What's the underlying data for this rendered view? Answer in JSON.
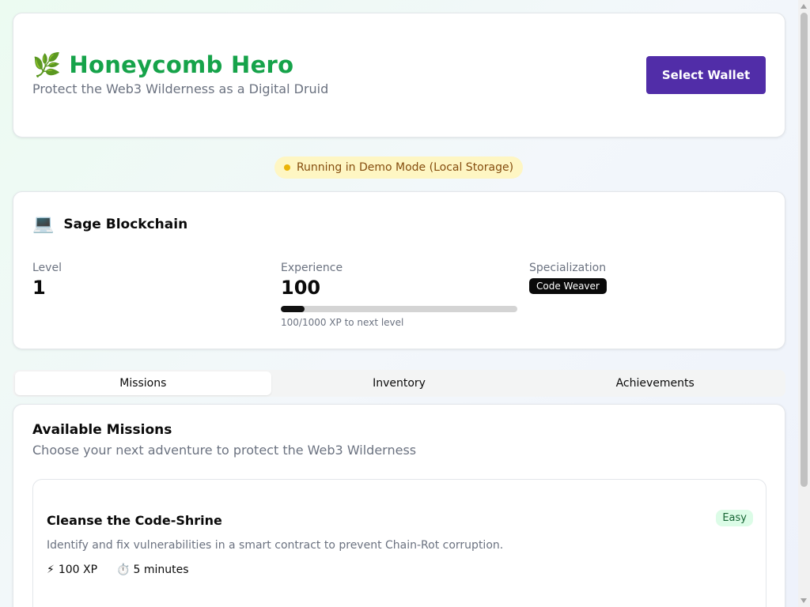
{
  "header": {
    "logo_icon": "🌿",
    "title": "Honeycomb Hero",
    "subtitle": "Protect the Web3 Wilderness as a Digital Druid",
    "wallet_button": "Select Wallet"
  },
  "demo_banner": "Running in Demo Mode (Local Storage)",
  "character": {
    "avatar_icon": "💻",
    "name": "Sage Blockchain",
    "level_label": "Level",
    "level": "1",
    "xp_label": "Experience",
    "xp": "100",
    "xp_progress": 0.1,
    "xp_note": "100/1000 XP to next level",
    "spec_label": "Specialization",
    "spec": "Code Weaver"
  },
  "tabs": [
    "Missions",
    "Inventory",
    "Achievements"
  ],
  "active_tab": 0,
  "missions": {
    "title": "Available Missions",
    "subtitle": "Choose your next adventure to protect the Web3 Wilderness",
    "items": [
      {
        "name": "Cleanse the Code-Shrine",
        "difficulty": "Easy",
        "description": "Identify and fix vulnerabilities in a smart contract to prevent Chain-Rot corruption.",
        "xp_icon": "⚡",
        "xp": "100 XP",
        "time_icon": "⏱️",
        "time": "5 minutes"
      }
    ]
  },
  "colors": {
    "brand": "#16a34a",
    "wallet_button": "#512da8",
    "demo_bg": "#fef6c3",
    "easy_bg": "#dcfce7"
  }
}
